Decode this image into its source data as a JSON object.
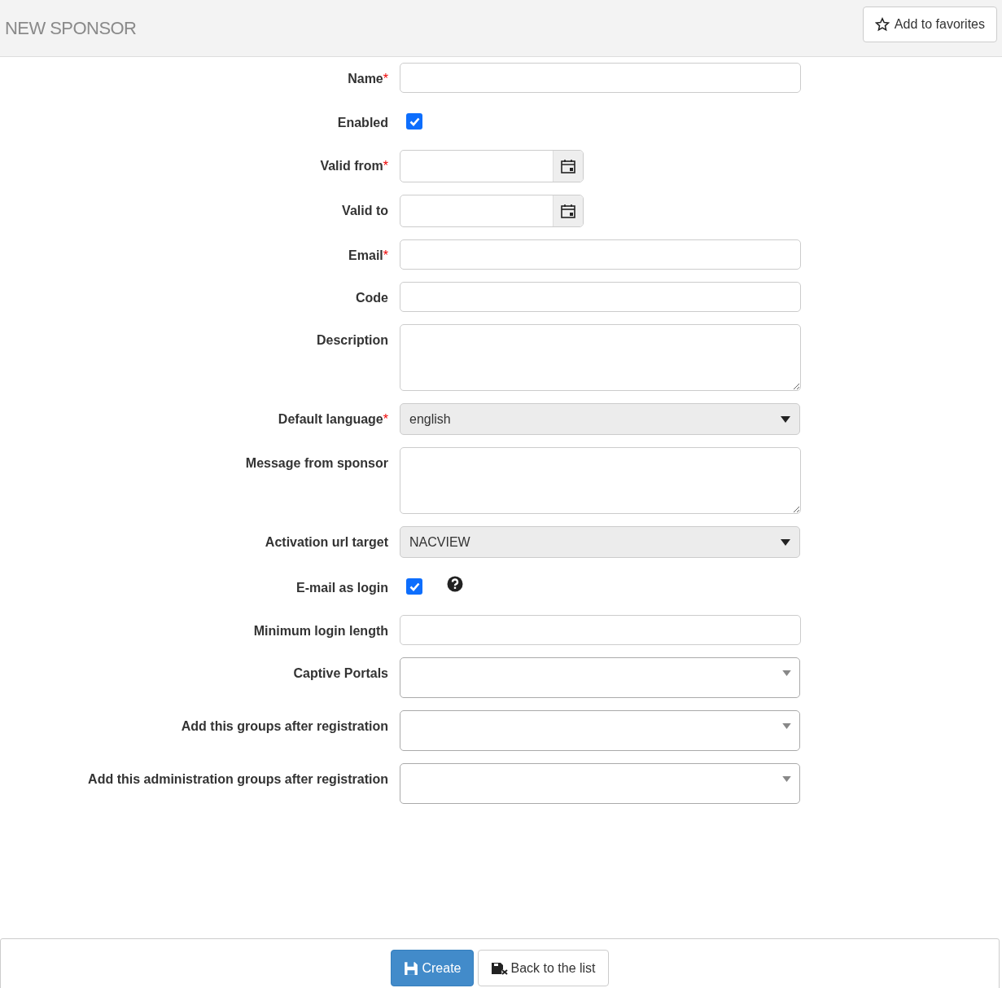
{
  "header": {
    "title": "NEW SPONSOR",
    "favorites_button": "Add to favorites"
  },
  "fields": [
    {
      "kind": "text",
      "label": "Name",
      "required_mark": "*"
    },
    {
      "kind": "checkbox",
      "label": "Enabled",
      "checked": true
    },
    {
      "kind": "date",
      "label": "Valid from",
      "required_mark": "*"
    },
    {
      "kind": "date",
      "label": "Valid to"
    },
    {
      "kind": "text",
      "label": "Email",
      "required_mark": "*"
    },
    {
      "kind": "text",
      "label": "Code"
    },
    {
      "kind": "textarea",
      "label": "Description"
    },
    {
      "kind": "select",
      "label": "Default language",
      "required_mark": "*",
      "value": "english"
    },
    {
      "kind": "textarea",
      "label": "Message from sponsor"
    },
    {
      "kind": "select",
      "label": "Activation url target",
      "value": "NACVIEW"
    },
    {
      "kind": "checkbox",
      "label": "E-mail as login",
      "checked": true,
      "help": true
    },
    {
      "kind": "text",
      "label": "Minimum login length"
    },
    {
      "kind": "multiselect",
      "label": "Captive Portals"
    },
    {
      "kind": "multiselect",
      "label": "Add this groups after registration"
    },
    {
      "kind": "multiselect",
      "label": "Add this administration groups after registration"
    }
  ],
  "footer": {
    "create_button": "Create",
    "back_button": "Back to the list"
  }
}
